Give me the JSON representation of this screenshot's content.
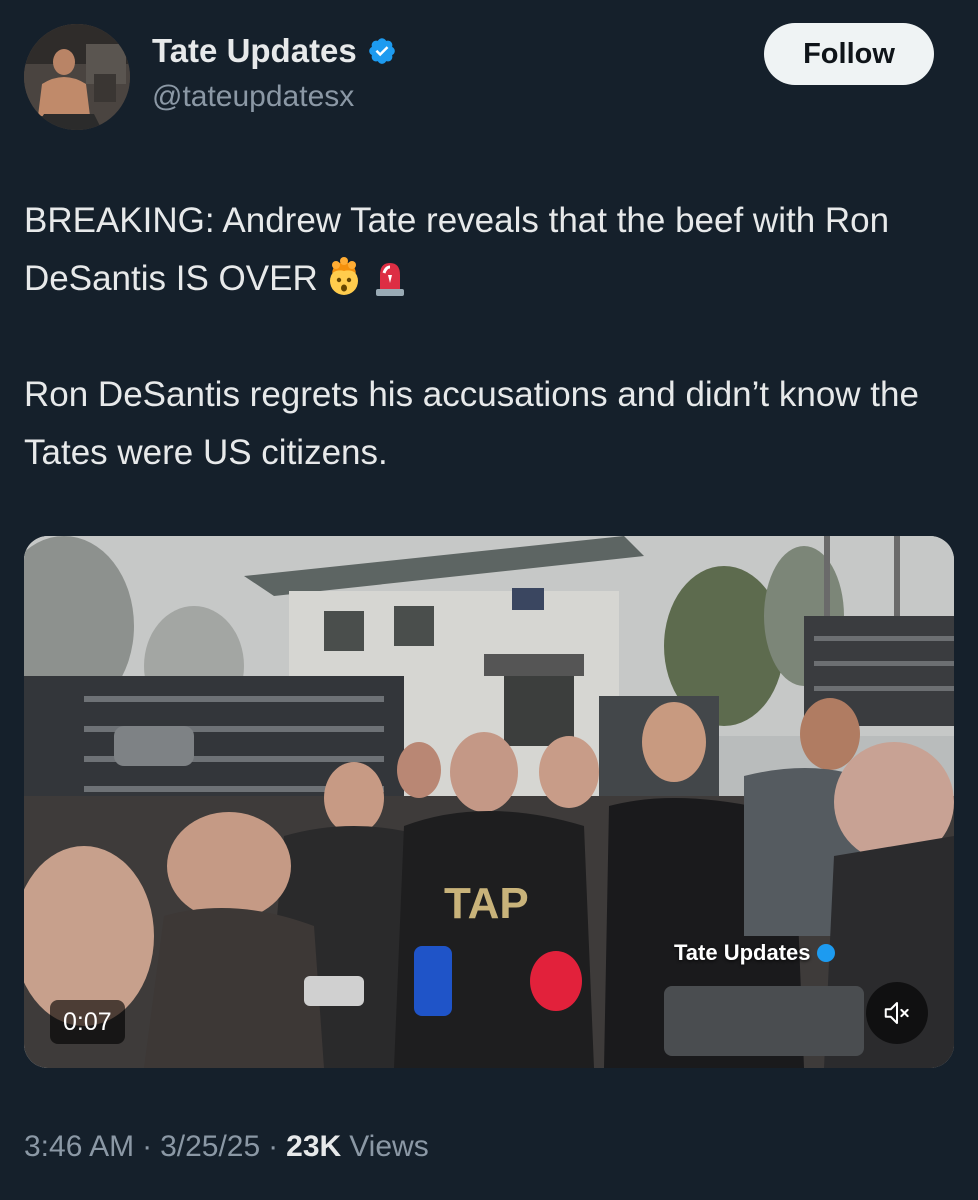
{
  "author": {
    "display_name": "Tate Updates",
    "handle": "@tateupdatesx",
    "verified": true,
    "avatar_icon": "profile-photo"
  },
  "follow_button": {
    "label": "Follow"
  },
  "tweet": {
    "paragraph1": "BREAKING: Andrew Tate reveals that the beef with Ron DeSantis IS OVER",
    "paragraph1_emojis": [
      "exploding-head-emoji",
      "police-light-emoji"
    ],
    "paragraph2": "Ron DeSantis regrets his accusations and didn’t know the Tates were US citizens."
  },
  "media": {
    "type": "video",
    "duration": "0:07",
    "watermark": "Tate Updates",
    "muted": true,
    "mute_icon": "speaker-muted-icon"
  },
  "meta": {
    "time": "3:46 AM",
    "date": "3/25/25",
    "separator": "·",
    "views_count": "23K",
    "views_label": "Views"
  },
  "colors": {
    "background": "#15202b",
    "text_primary": "#e7e9ea",
    "text_secondary": "#8b98a5",
    "verified_blue": "#1d9bf0",
    "follow_bg": "#eff3f4"
  }
}
